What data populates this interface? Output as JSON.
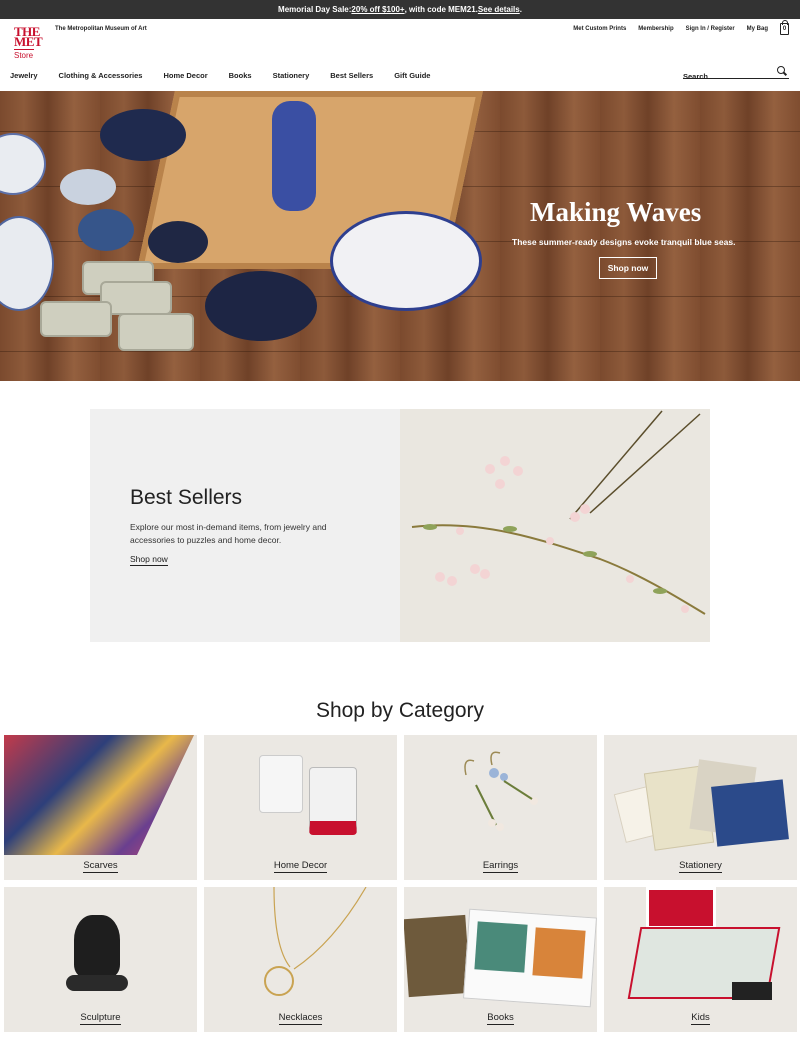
{
  "promo": {
    "prefix": "Memorial Day Sale: ",
    "offer": "20% off $100+",
    "middle": ", with code MEM21. ",
    "details": "See details",
    "suffix": "."
  },
  "logo": {
    "line1": "THE",
    "line2": "MET",
    "line3": "Store"
  },
  "header": {
    "museum_name": "The Metropolitan Museum of Art",
    "utility_links": [
      "Met Custom Prints",
      "Membership",
      "Sign In / Register",
      "My Bag"
    ],
    "bag_count": "0"
  },
  "nav": {
    "items": [
      "Jewelry",
      "Clothing & Accessories",
      "Home Decor",
      "Books",
      "Stationery",
      "Best Sellers",
      "Gift Guide"
    ]
  },
  "search": {
    "placeholder": "Search"
  },
  "hero": {
    "title": "Making Waves",
    "subtitle": "These summer-ready designs evoke tranquil blue seas.",
    "button": "Shop now"
  },
  "best_sellers": {
    "title": "Best Sellers",
    "description": "Explore our most in-demand items, from jewelry and accessories to puzzles and home decor.",
    "link": "Shop now"
  },
  "categories": {
    "heading": "Shop by Category",
    "items": [
      "Scarves",
      "Home Decor",
      "Earrings",
      "Stationery",
      "Sculpture",
      "Necklaces",
      "Books",
      "Kids"
    ]
  },
  "colors": {
    "brand_red": "#c8102e",
    "promo_bg": "#333333"
  }
}
